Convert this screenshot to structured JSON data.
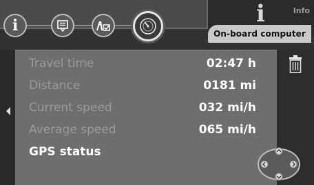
{
  "header": {
    "section_title": "On-board computer",
    "logo_text": "Info",
    "nav_icons": [
      "info-icon",
      "messages-icon",
      "route-icon",
      "speedometer-icon"
    ]
  },
  "rows": [
    {
      "label": "Travel time",
      "value": "02:47 h"
    },
    {
      "label": "Distance",
      "value": "0181 mi"
    },
    {
      "label": "Current speed",
      "value": "032 mi/h"
    },
    {
      "label": "Average speed",
      "value": "065 mi/h"
    },
    {
      "label": "GPS status",
      "value": ""
    }
  ],
  "colors": {
    "content_bg": "#6e6e6e",
    "label_dim": "#9a9a9a",
    "label_active": "#ffffff",
    "tab_bg": "#c9c9c9"
  },
  "icons": [
    "trash-icon",
    "left-arrow-icon",
    "joystick-icon"
  ]
}
